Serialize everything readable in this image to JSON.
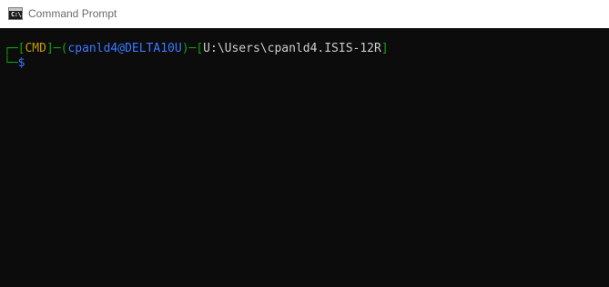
{
  "window": {
    "title": "Command Prompt",
    "icon_text": "C:\\."
  },
  "prompt": {
    "box_top": "┌─",
    "open1": "[",
    "shell": "CMD",
    "close1": "]",
    "dash1": "─",
    "open2": "(",
    "user_host": "cpanld4@DELTA10U",
    "close2": ")",
    "dash2": "─",
    "open3": "[",
    "path": "U:\\Users\\cpanld4.ISIS-12R",
    "close3": "]",
    "box_bottom": "└─",
    "symbol": "$"
  },
  "colors": {
    "background": "#0c0c0c",
    "green": "#13a10e",
    "yellow": "#c19c00",
    "blue": "#3b78ff",
    "white": "#cccccc"
  }
}
